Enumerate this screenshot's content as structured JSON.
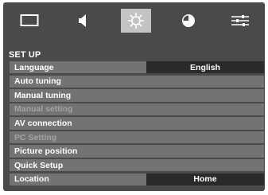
{
  "tabs": [
    {
      "icon": "picture-icon",
      "active": false
    },
    {
      "icon": "sound-icon",
      "active": false
    },
    {
      "icon": "setup-gear-icon",
      "active": true
    },
    {
      "icon": "timer-clock-icon",
      "active": false
    },
    {
      "icon": "options-sliders-icon",
      "active": false
    }
  ],
  "section_title": "SET UP",
  "menu": {
    "items": [
      {
        "label": "Language",
        "value": "English",
        "enabled": true
      },
      {
        "label": "Auto tuning",
        "enabled": true
      },
      {
        "label": "Manual tuning",
        "enabled": true
      },
      {
        "label": "Manual setting",
        "enabled": false
      },
      {
        "label": "AV connection",
        "enabled": true
      },
      {
        "label": "PC Setting",
        "enabled": false
      },
      {
        "label": "Picture position",
        "enabled": true
      },
      {
        "label": "Quick Setup",
        "enabled": true
      },
      {
        "label": "Location",
        "value": "Home",
        "enabled": true
      }
    ]
  },
  "colors": {
    "background": "#4a4a4a",
    "row": "#737373",
    "value_box": "#2a2a2a",
    "active_tab": "#c3c3c3",
    "disabled_text": "#a3a3a3"
  }
}
